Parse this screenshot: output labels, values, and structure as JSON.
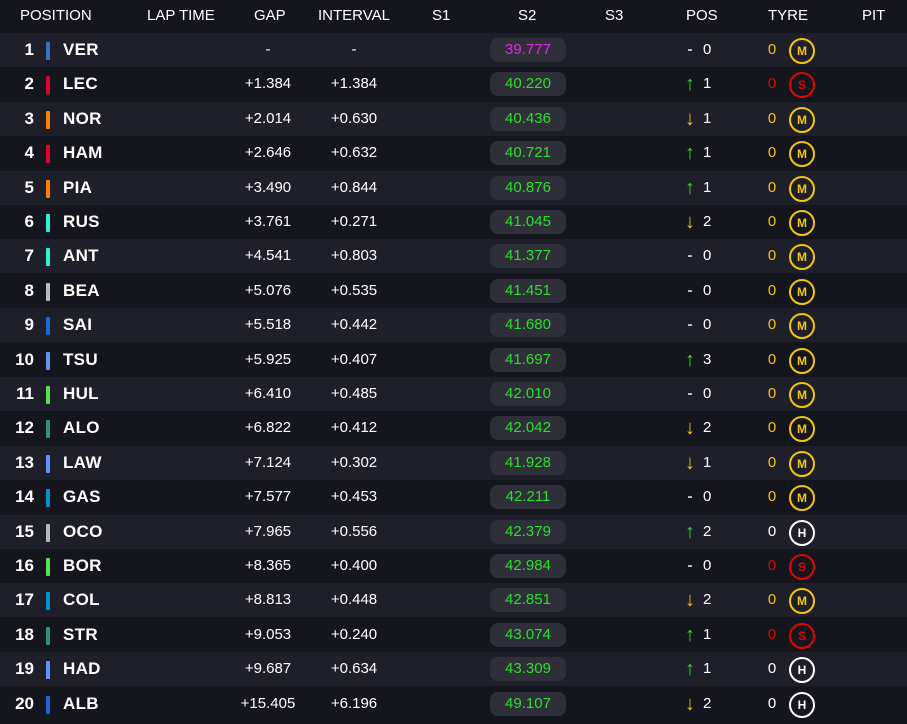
{
  "header": {
    "position": "POSITION",
    "lap_time": "LAP TIME",
    "gap": "GAP",
    "interval": "INTERVAL",
    "s1": "S1",
    "s2": "S2",
    "s3": "S3",
    "pos": "POS",
    "tyre": "TYRE",
    "pit": "PIT"
  },
  "colors": {
    "green": "#29e02b",
    "purple": "#e22ae6",
    "yellow": "#f3c60b",
    "red": "#e10600"
  },
  "rows": [
    {
      "pos": "1",
      "driver": "VER",
      "team_color": "#3671c6",
      "gap": "-",
      "interval": "-",
      "s2": "39.777",
      "s2_color": "purple",
      "trend": "none",
      "trend_glyph": "-",
      "change": "0",
      "pits": "0",
      "pits_color": "yellow",
      "tyre": "M",
      "tyre_type": "medium"
    },
    {
      "pos": "2",
      "driver": "LEC",
      "team_color": "#e8002d",
      "gap": "+1.384",
      "interval": "+1.384",
      "s2": "40.220",
      "s2_color": "green",
      "trend": "up",
      "trend_glyph": "↑",
      "change": "1",
      "pits": "0",
      "pits_color": "red",
      "tyre": "S",
      "tyre_type": "soft"
    },
    {
      "pos": "3",
      "driver": "NOR",
      "team_color": "#ff8000",
      "gap": "+2.014",
      "interval": "+0.630",
      "s2": "40.436",
      "s2_color": "green",
      "trend": "down",
      "trend_glyph": "↓",
      "change": "1",
      "pits": "0",
      "pits_color": "yellow",
      "tyre": "M",
      "tyre_type": "medium"
    },
    {
      "pos": "4",
      "driver": "HAM",
      "team_color": "#e8002d",
      "gap": "+2.646",
      "interval": "+0.632",
      "s2": "40.721",
      "s2_color": "green",
      "trend": "up",
      "trend_glyph": "↑",
      "change": "1",
      "pits": "0",
      "pits_color": "yellow",
      "tyre": "M",
      "tyre_type": "medium"
    },
    {
      "pos": "5",
      "driver": "PIA",
      "team_color": "#ff8000",
      "gap": "+3.490",
      "interval": "+0.844",
      "s2": "40.876",
      "s2_color": "green",
      "trend": "up",
      "trend_glyph": "↑",
      "change": "1",
      "pits": "0",
      "pits_color": "yellow",
      "tyre": "M",
      "tyre_type": "medium"
    },
    {
      "pos": "6",
      "driver": "RUS",
      "team_color": "#27f4d2",
      "gap": "+3.761",
      "interval": "+0.271",
      "s2": "41.045",
      "s2_color": "green",
      "trend": "down",
      "trend_glyph": "↓",
      "change": "2",
      "pits": "0",
      "pits_color": "yellow",
      "tyre": "M",
      "tyre_type": "medium"
    },
    {
      "pos": "7",
      "driver": "ANT",
      "team_color": "#27f4d2",
      "gap": "+4.541",
      "interval": "+0.803",
      "s2": "41.377",
      "s2_color": "green",
      "trend": "none",
      "trend_glyph": "-",
      "change": "0",
      "pits": "0",
      "pits_color": "yellow",
      "tyre": "M",
      "tyre_type": "medium"
    },
    {
      "pos": "8",
      "driver": "BEA",
      "team_color": "#b6babd",
      "gap": "+5.076",
      "interval": "+0.535",
      "s2": "41.451",
      "s2_color": "green",
      "trend": "none",
      "trend_glyph": "-",
      "change": "0",
      "pits": "0",
      "pits_color": "yellow",
      "tyre": "M",
      "tyre_type": "medium"
    },
    {
      "pos": "9",
      "driver": "SAI",
      "team_color": "#1868db",
      "gap": "+5.518",
      "interval": "+0.442",
      "s2": "41.680",
      "s2_color": "green",
      "trend": "none",
      "trend_glyph": "-",
      "change": "0",
      "pits": "0",
      "pits_color": "yellow",
      "tyre": "M",
      "tyre_type": "medium"
    },
    {
      "pos": "10",
      "driver": "TSU",
      "team_color": "#6692ff",
      "gap": "+5.925",
      "interval": "+0.407",
      "s2": "41.697",
      "s2_color": "green",
      "trend": "up",
      "trend_glyph": "↑",
      "change": "3",
      "pits": "0",
      "pits_color": "yellow",
      "tyre": "M",
      "tyre_type": "medium"
    },
    {
      "pos": "11",
      "driver": "HUL",
      "team_color": "#52e252",
      "gap": "+6.410",
      "interval": "+0.485",
      "s2": "42.010",
      "s2_color": "green",
      "trend": "none",
      "trend_glyph": "-",
      "change": "0",
      "pits": "0",
      "pits_color": "yellow",
      "tyre": "M",
      "tyre_type": "medium"
    },
    {
      "pos": "12",
      "driver": "ALO",
      "team_color": "#229971",
      "gap": "+6.822",
      "interval": "+0.412",
      "s2": "42.042",
      "s2_color": "green",
      "trend": "down",
      "trend_glyph": "↓",
      "change": "2",
      "pits": "0",
      "pits_color": "yellow",
      "tyre": "M",
      "tyre_type": "medium"
    },
    {
      "pos": "13",
      "driver": "LAW",
      "team_color": "#6692ff",
      "gap": "+7.124",
      "interval": "+0.302",
      "s2": "41.928",
      "s2_color": "green",
      "trend": "down",
      "trend_glyph": "↓",
      "change": "1",
      "pits": "0",
      "pits_color": "yellow",
      "tyre": "M",
      "tyre_type": "medium"
    },
    {
      "pos": "14",
      "driver": "GAS",
      "team_color": "#0093cc",
      "gap": "+7.577",
      "interval": "+0.453",
      "s2": "42.211",
      "s2_color": "green",
      "trend": "none",
      "trend_glyph": "-",
      "change": "0",
      "pits": "0",
      "pits_color": "yellow",
      "tyre": "M",
      "tyre_type": "medium"
    },
    {
      "pos": "15",
      "driver": "OCO",
      "team_color": "#b6babd",
      "gap": "+7.965",
      "interval": "+0.556",
      "s2": "42.379",
      "s2_color": "green",
      "trend": "up",
      "trend_glyph": "↑",
      "change": "2",
      "pits": "0",
      "pits_color": "white",
      "tyre": "H",
      "tyre_type": "hard"
    },
    {
      "pos": "16",
      "driver": "BOR",
      "team_color": "#52e252",
      "gap": "+8.365",
      "interval": "+0.400",
      "s2": "42.984",
      "s2_color": "green",
      "trend": "none",
      "trend_glyph": "-",
      "change": "0",
      "pits": "0",
      "pits_color": "red",
      "tyre": "S",
      "tyre_type": "soft"
    },
    {
      "pos": "17",
      "driver": "COL",
      "team_color": "#0093cc",
      "gap": "+8.813",
      "interval": "+0.448",
      "s2": "42.851",
      "s2_color": "green",
      "trend": "down",
      "trend_glyph": "↓",
      "change": "2",
      "pits": "0",
      "pits_color": "yellow",
      "tyre": "M",
      "tyre_type": "medium"
    },
    {
      "pos": "18",
      "driver": "STR",
      "team_color": "#229971",
      "gap": "+9.053",
      "interval": "+0.240",
      "s2": "43.074",
      "s2_color": "green",
      "trend": "up",
      "trend_glyph": "↑",
      "change": "1",
      "pits": "0",
      "pits_color": "red",
      "tyre": "S",
      "tyre_type": "soft"
    },
    {
      "pos": "19",
      "driver": "HAD",
      "team_color": "#6692ff",
      "gap": "+9.687",
      "interval": "+0.634",
      "s2": "43.309",
      "s2_color": "green",
      "trend": "up",
      "trend_glyph": "↑",
      "change": "1",
      "pits": "0",
      "pits_color": "white",
      "tyre": "H",
      "tyre_type": "hard"
    },
    {
      "pos": "20",
      "driver": "ALB",
      "team_color": "#1868db",
      "gap": "+15.405",
      "interval": "+6.196",
      "s2": "49.107",
      "s2_color": "green",
      "trend": "down",
      "trend_glyph": "↓",
      "change": "2",
      "pits": "0",
      "pits_color": "white",
      "tyre": "H",
      "tyre_type": "hard"
    }
  ]
}
